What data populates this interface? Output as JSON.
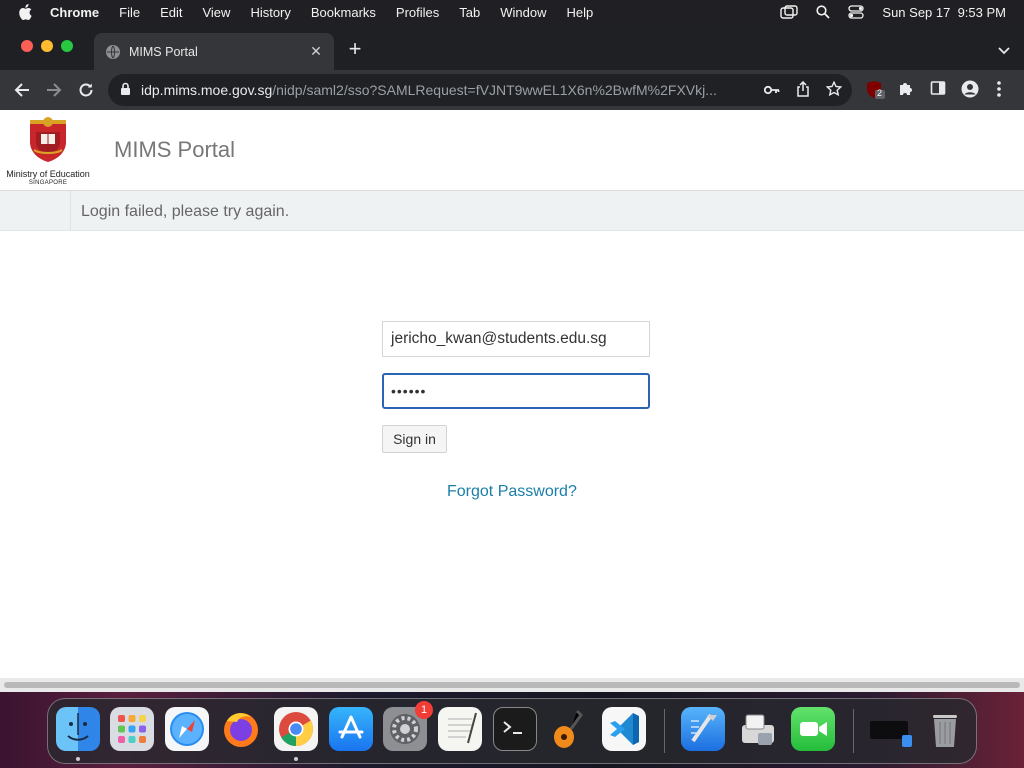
{
  "menubar": {
    "app_name": "Chrome",
    "items": [
      "File",
      "Edit",
      "View",
      "History",
      "Bookmarks",
      "Profiles",
      "Tab",
      "Window",
      "Help"
    ],
    "clock": "Sun Sep 17  9:53 PM"
  },
  "browser": {
    "tab_title": "MIMS Portal",
    "url_host": "idp.mims.moe.gov.sg",
    "url_rest": "/nidp/saml2/sso?SAMLRequest=fVJNT9wwEL1X6n%2BwfM%2FXVkj...",
    "extension_badge": "2"
  },
  "page": {
    "logo_ministry": "Ministry of Education",
    "logo_country": "SINGAPORE",
    "portal_title": "MIMS Portal",
    "alert_message": "Login failed, please try again.",
    "username_value": "jericho_kwan@students.edu.sg",
    "password_value": "••••••",
    "signin_label": "Sign in",
    "forgot_label": "Forgot Password?"
  },
  "dock": {
    "apps": [
      "finder",
      "launchpad",
      "safari",
      "firefox",
      "chrome",
      "app-store",
      "system-settings",
      "textedit",
      "terminal",
      "garageband",
      "vscode",
      "xcode-instruments",
      "migration-assistant",
      "facetime",
      "finder-window",
      "trash"
    ],
    "settings_badge": "1"
  },
  "colors": {
    "accent_link": "#1a7ea8",
    "focus_border": "#2a64b2",
    "alert_bg": "#eff2f3"
  }
}
